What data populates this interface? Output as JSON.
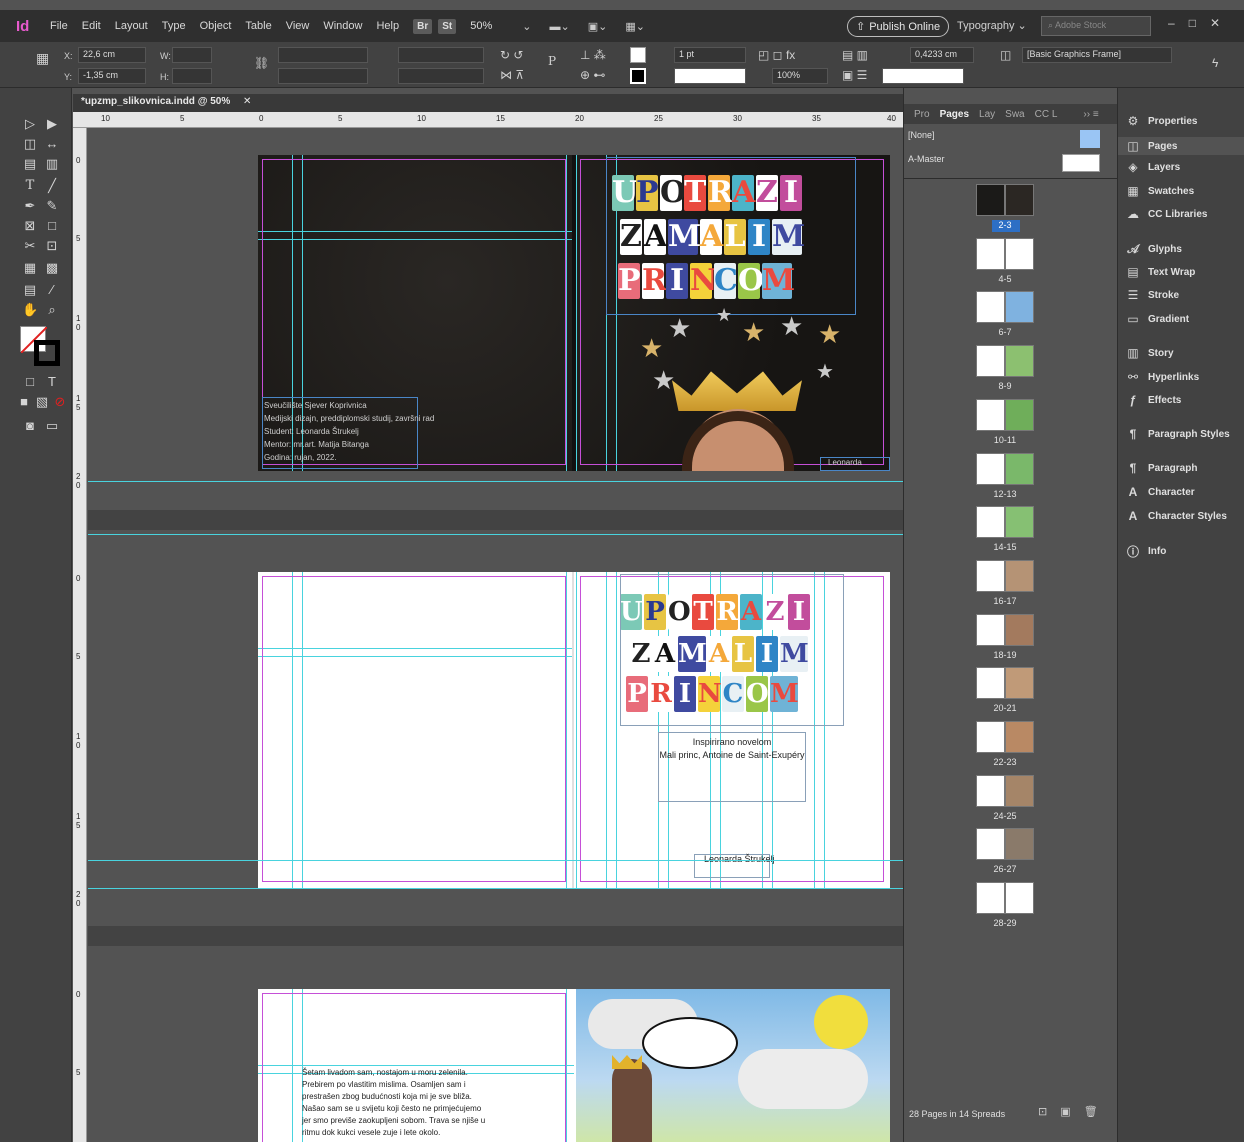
{
  "app": {
    "logo": "Id",
    "menu": [
      "File",
      "Edit",
      "Layout",
      "Type",
      "Object",
      "Table",
      "View",
      "Window",
      "Help"
    ],
    "bridge": "Br",
    "stock": "St",
    "zoom": "50%",
    "publish": "Publish Online",
    "workspace": "Typography",
    "stock_search_placeholder": "Adobe Stock"
  },
  "control": {
    "x_label": "X:",
    "x_value": "22,6 cm",
    "y_label": "Y:",
    "y_value": "-1,35 cm",
    "w_label": "W:",
    "h_label": "H:",
    "stroke_weight": "1 pt",
    "opacity": "100%",
    "offset": "0,4233 cm",
    "object_style": "[Basic Graphics Frame]"
  },
  "document": {
    "tab_title": "*upzmp_slikovnica.indd @ 50%",
    "ruler_numbers": [
      "10",
      "5",
      "0",
      "5",
      "10",
      "15",
      "20",
      "25",
      "30",
      "35",
      "40"
    ],
    "vruler_numbers": [
      "0",
      "5",
      "1 0",
      "1 5",
      "2 0"
    ]
  },
  "spread1": {
    "credits": [
      "Sveučilište Sjever Koprivnica",
      "Medijski dizajn, preddiplomski studij, završni rad",
      "Student: Leonarda Štrukelj",
      "Mentor: mr.art. Matija Bitanga",
      "Godina: rujan, 2022."
    ],
    "author": "Leonarda Štrukelj"
  },
  "title_lines": [
    [
      "U",
      "P",
      "O",
      "T",
      "R",
      "A",
      "Z",
      "I"
    ],
    [
      "Z",
      "A",
      "M",
      "A",
      "L",
      "I",
      "M"
    ],
    [
      "P",
      "R",
      "I",
      "N",
      "C",
      "O",
      "M"
    ]
  ],
  "spread2": {
    "inspired_line1": "Inspirirano novelom",
    "inspired_line2": "Mali princ, Antoine de Saint-Exupéry",
    "author": "Leonarda Štrukelj"
  },
  "spread3": {
    "story_text": [
      "Šetam livadom sam, nostajom u moru zelenila.",
      "Prebirem po vlastitim mislima. Osamljen sam i",
      "prestrašen zbog budućnosti koja mi je sve bliža.",
      "Našao sam se u svijetu koji često ne primjećujemo",
      "jer smo previše zaokupljeni sobom. Trava se njiše u",
      "ritmu dok kukci vesele zuje i lete okolo."
    ]
  },
  "pages_panel": {
    "tabs": [
      "Pro",
      "Pages",
      "Lay",
      "Swa",
      "CC L"
    ],
    "none_label": "[None]",
    "master_label": "A-Master",
    "spreads": [
      "2-3",
      "4-5",
      "6-7",
      "8-9",
      "10-11",
      "12-13",
      "14-15",
      "16-17",
      "18-19",
      "20-21",
      "22-23",
      "24-25",
      "26-27",
      "28-29"
    ],
    "footer": "28 Pages in 14 Spreads"
  },
  "dock": [
    {
      "label": "Properties",
      "icon": "properties-icon"
    },
    {
      "label": "Pages",
      "icon": "pages-icon"
    },
    {
      "label": "Layers",
      "icon": "layers-icon"
    },
    {
      "label": "Swatches",
      "icon": "swatches-icon"
    },
    {
      "label": "CC Libraries",
      "icon": "cc-libraries-icon"
    },
    {
      "label": "Glyphs",
      "icon": "glyphs-icon"
    },
    {
      "label": "Text Wrap",
      "icon": "text-wrap-icon"
    },
    {
      "label": "Stroke",
      "icon": "stroke-icon"
    },
    {
      "label": "Gradient",
      "icon": "gradient-icon"
    },
    {
      "label": "Story",
      "icon": "story-icon"
    },
    {
      "label": "Hyperlinks",
      "icon": "hyperlinks-icon"
    },
    {
      "label": "Effects",
      "icon": "effects-icon"
    },
    {
      "label": "Paragraph Styles",
      "icon": "paragraph-styles-icon"
    },
    {
      "label": "Paragraph",
      "icon": "paragraph-icon"
    },
    {
      "label": "Character",
      "icon": "character-icon"
    },
    {
      "label": "Character Styles",
      "icon": "character-styles-icon"
    },
    {
      "label": "Info",
      "icon": "info-icon"
    }
  ],
  "colors": {
    "accent_magenta": "#e85acd",
    "guide": "#49d3de",
    "margin": "#c54fd7",
    "selection": "#4a86c7"
  }
}
